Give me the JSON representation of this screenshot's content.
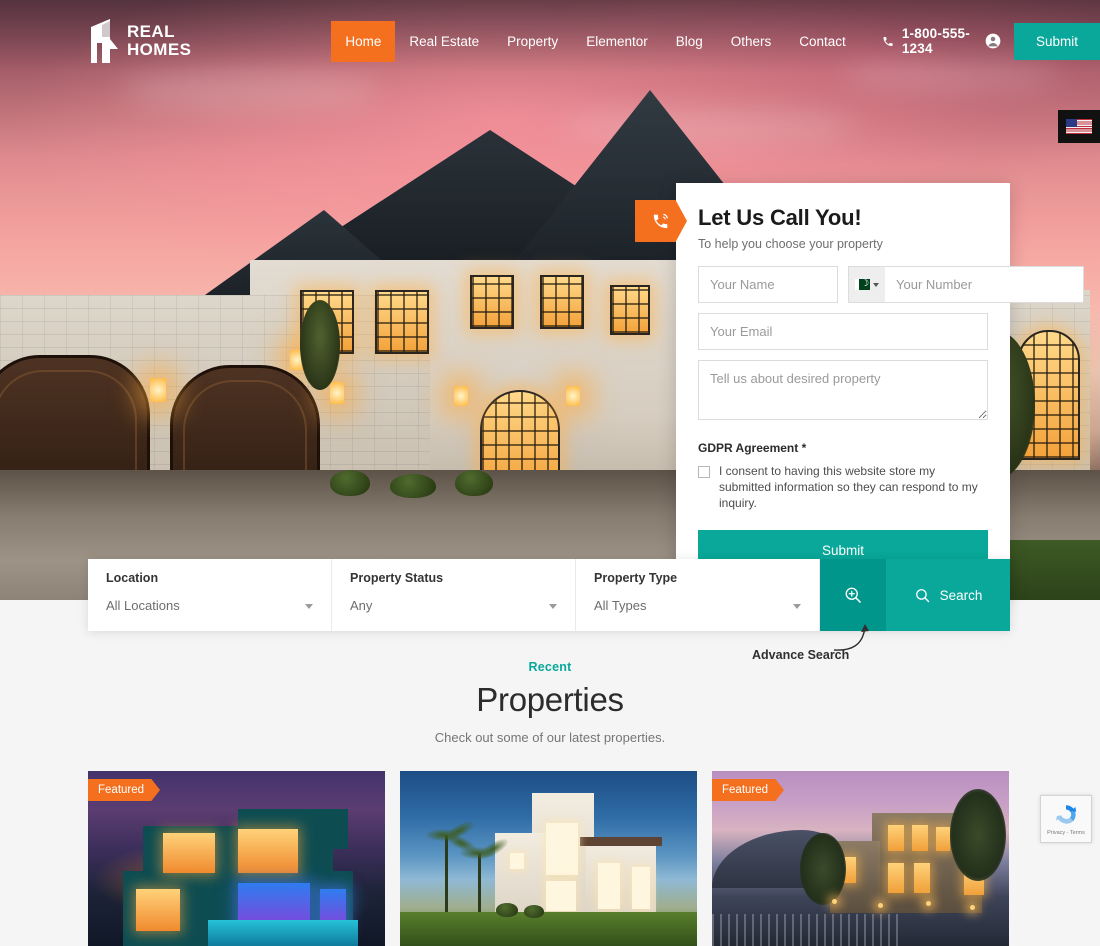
{
  "nav": {
    "logo_line1": "REAL",
    "logo_line2": "HOMES",
    "logo_icon": "house-r-logo-icon",
    "items": [
      {
        "label": "Home",
        "active": true
      },
      {
        "label": "Real Estate",
        "active": false
      },
      {
        "label": "Property",
        "active": false
      },
      {
        "label": "Elementor",
        "active": false
      },
      {
        "label": "Blog",
        "active": false
      },
      {
        "label": "Others",
        "active": false
      },
      {
        "label": "Contact",
        "active": false
      }
    ],
    "phone_icon": "phone-icon",
    "phone": "1-800-555-1234",
    "account_icon": "user-account-icon",
    "submit_label": "Submit",
    "active_color": "#f4701f",
    "accent_color": "#09a89a"
  },
  "language_switcher": {
    "flag_icon": "us-flag-icon",
    "label": "English"
  },
  "callback_form": {
    "tab_icon": "phone-ring-icon",
    "title": "Let Us Call You!",
    "subtitle": "To help you choose your property",
    "name_placeholder": "Your Name",
    "country_flag_icon": "pakistan-flag-icon",
    "number_placeholder": "Your Number",
    "email_placeholder": "Your Email",
    "message_placeholder": "Tell us about desired property",
    "gdpr_title": "GDPR Agreement *",
    "gdpr_text": "I consent to having this website store my submitted information so they can respond to my inquiry.",
    "gdpr_checked": false,
    "submit_label": "Submit"
  },
  "search_bar": {
    "fields": [
      {
        "label": "Location",
        "value": "All Locations"
      },
      {
        "label": "Property Status",
        "value": "Any"
      },
      {
        "label": "Property Type",
        "value": "All Types"
      }
    ],
    "advance_icon": "magnifier-plus-icon",
    "search_icon": "search-icon",
    "search_label": "Search",
    "annotation": "Advance Search"
  },
  "properties": {
    "eyebrow": "Recent",
    "title": "Properties",
    "subtitle": "Check out some of our latest properties.",
    "cards": [
      {
        "badge": "Featured",
        "image_alt": "modern-teal-house-at-night"
      },
      {
        "badge": "",
        "image_alt": "white-villa-with-palm-trees"
      },
      {
        "badge": "Featured",
        "image_alt": "hillside-villa-with-pool"
      }
    ]
  },
  "recaptcha": {
    "icon": "recaptcha-icon",
    "terms": "Privacy - Terms"
  }
}
